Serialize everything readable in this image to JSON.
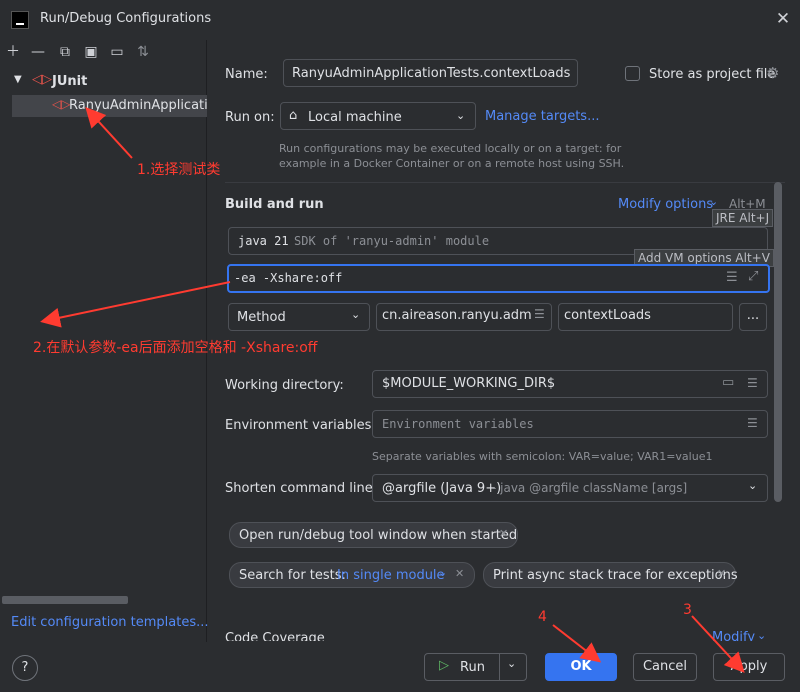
{
  "window": {
    "title": "Run/Debug Configurations"
  },
  "left": {
    "junit_label": "JUnit",
    "selected_item": "RanyuAdminApplicationTests.contextLoads",
    "edit_templates": "Edit configuration templates..."
  },
  "form": {
    "name_label": "Name:",
    "name_value": "RanyuAdminApplicationTests.contextLoads",
    "store_label": "Store as project file",
    "run_on_label": "Run on:",
    "run_on_value": "Local machine",
    "manage_targets": "Manage targets...",
    "run_on_hint_1": "Run configurations may be executed locally or on a target: for",
    "run_on_hint_2": "example in a Docker Container or on a remote host using SSH.",
    "build_run": "Build and run",
    "modify_options": "Modify options",
    "modify_shortcut": "Alt+M",
    "jre_tip": "JRE Alt+J",
    "jdk_java": "java 21",
    "jdk_desc": "SDK of 'ranyu-admin' module",
    "vm_tip": "Add VM options Alt+V",
    "vm_value": "-ea -Xshare:off",
    "method_value": "Method",
    "class_value": "cn.aireason.ranyu.admin.R",
    "method_name": "contextLoads",
    "more": "...",
    "workdir_label": "Working directory:",
    "workdir_value": "$MODULE_WORKING_DIR$",
    "env_label": "Environment variables:",
    "env_placeholder": "Environment variables",
    "env_hint": "Separate variables with semicolon: VAR=value; VAR1=value1",
    "shorten_label": "Shorten command line:",
    "shorten_value": "@argfile (Java 9+)",
    "shorten_desc": " - java @argfile className [args]",
    "chip_open": "Open run/debug tool window when started",
    "chip_search_a": "Search for tests: ",
    "chip_search_b": "In single module",
    "chip_async": "Print async stack trace for exceptions",
    "code_coverage": "Code Coverage",
    "modify2": "Modify"
  },
  "annotations": {
    "a1": "1.选择测试类",
    "a2": "2.在默认参数-ea后面添加空格和 -Xshare:off",
    "a3": "3",
    "a4": "4"
  },
  "buttons": {
    "run": "Run",
    "ok": "OK",
    "cancel": "Cancel",
    "apply": "Apply",
    "help": "?"
  },
  "colors": {
    "accent": "#3574f0",
    "annotation": "#ff3b30",
    "link": "#548af7"
  }
}
